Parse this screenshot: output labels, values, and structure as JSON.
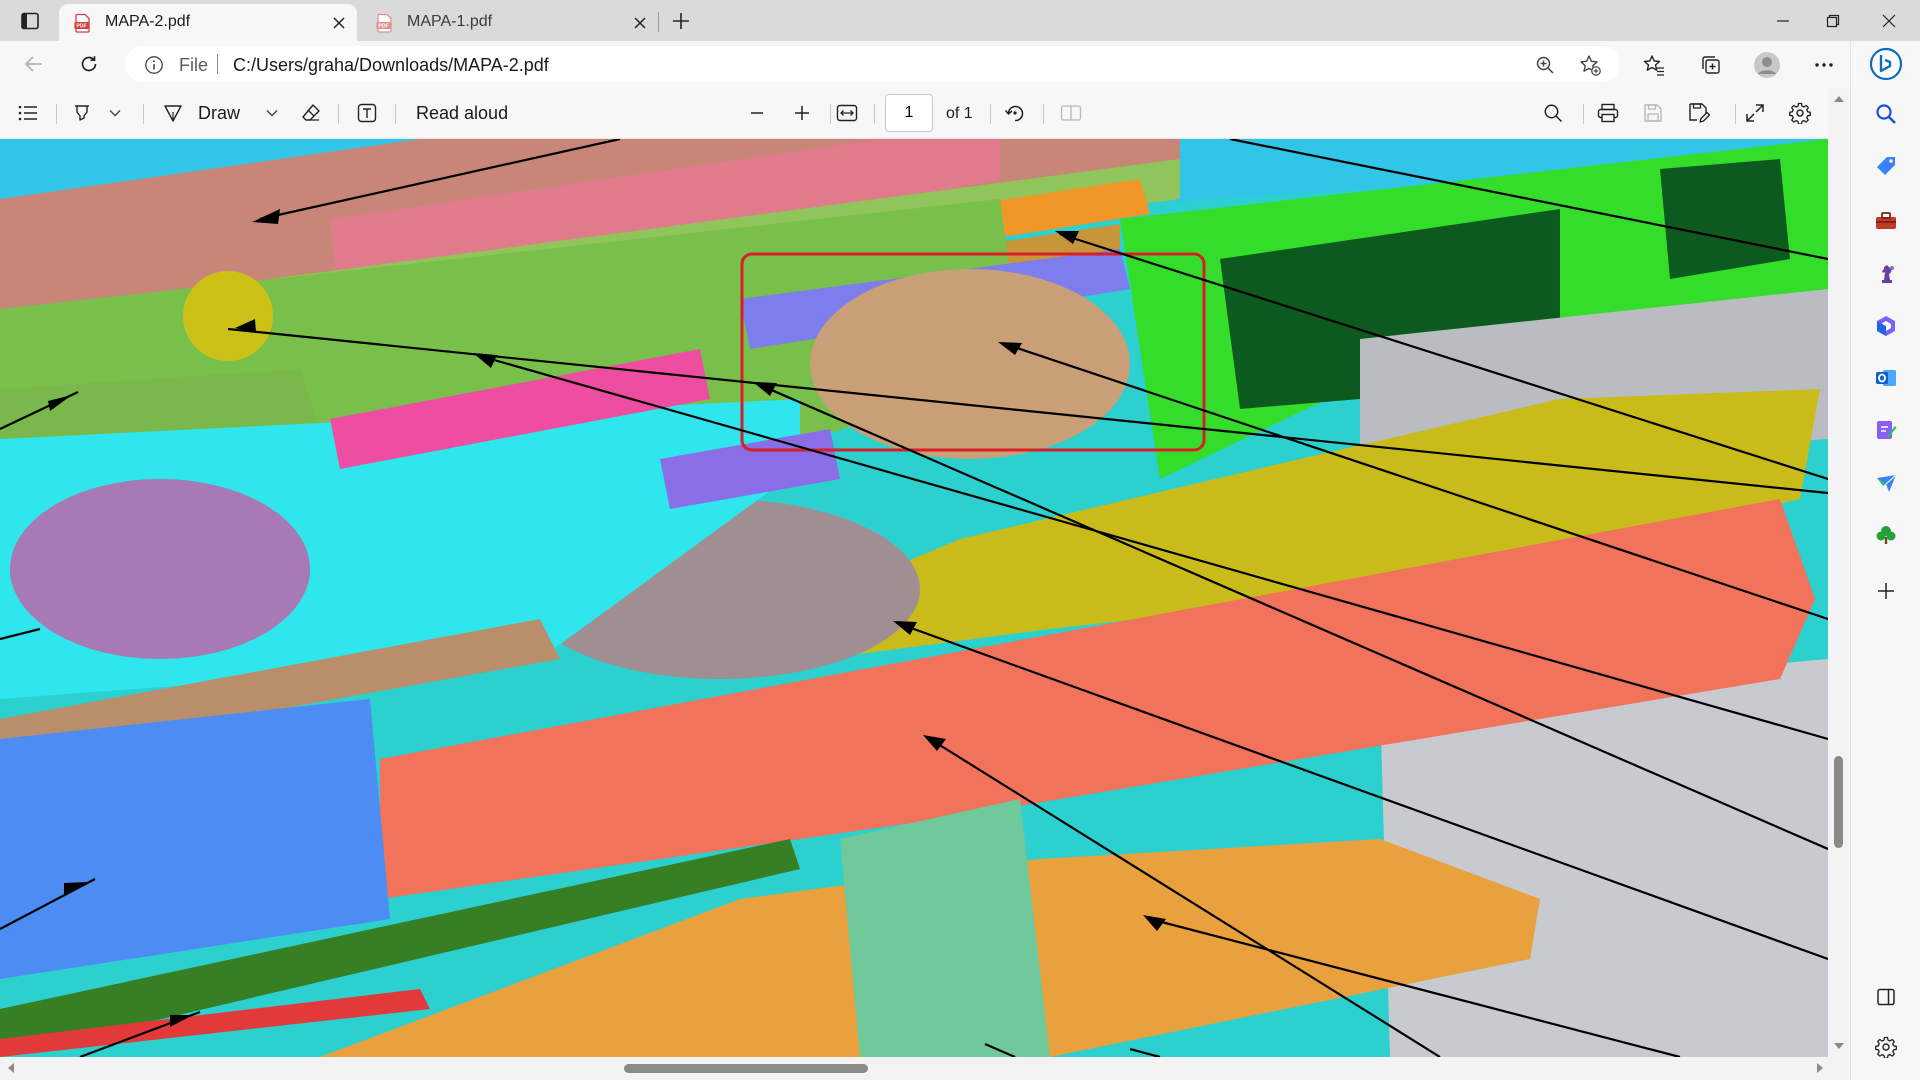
{
  "tabs": [
    {
      "title": "MAPA-2.pdf",
      "active": true
    },
    {
      "title": "MAPA-1.pdf",
      "active": false
    }
  ],
  "address_bar": {
    "scheme_label": "File",
    "url": "C:/Users/graha/Downloads/MAPA-2.pdf"
  },
  "pdf_toolbar": {
    "draw_label": "Draw",
    "read_aloud_label": "Read aloud",
    "page_number": "1",
    "page_total": "of 1"
  },
  "colors": {
    "accent_blue": "#0f6cbd",
    "pdf_red": "#d33d3d",
    "highlight_box": "#d81f26",
    "cyan": "#22e0ea",
    "salmon": "#f1745b",
    "yellow": "#cfc21a",
    "orange": "#e8a23e",
    "green": "#2bd62b",
    "purple": "#a57ab5",
    "blue": "#4c8bff"
  },
  "icons": {
    "tab_actions": "tab-actions-icon",
    "pdf_favicon": "pdf-file-icon",
    "close": "close-icon",
    "new_tab": "plus-icon",
    "minimize": "minimize-icon",
    "maximize": "maximize-icon",
    "window_close": "close-icon",
    "back": "back-arrow-icon",
    "refresh": "refresh-icon",
    "info": "info-icon",
    "zoom": "zoom-icon",
    "add_favorite": "add-favorite-icon",
    "favorites": "favorites-icon",
    "collections": "collections-icon",
    "profile": "profile-avatar-icon",
    "more": "more-icon",
    "copilot": "bing-copilot-icon"
  }
}
